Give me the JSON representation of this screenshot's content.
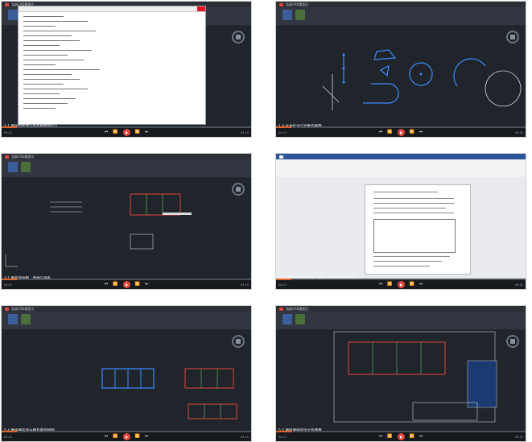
{
  "app": {
    "name": "浩辰CAD看图王"
  },
  "videos": [
    {
      "caption": "1.1 图层的新建与布局视图的切入",
      "time_current": "00:12",
      "time_total": "03:10",
      "progress": 0.06
    },
    {
      "caption": "1.4 文本标注与对象的编辑",
      "time_current": "00:12",
      "time_total": "03:10",
      "progress": 0.06
    },
    {
      "caption": "2.1 图形的绘制、直线与线条",
      "time_current": "00:12",
      "time_total": "03:10",
      "progress": 0.06
    },
    {
      "caption": "3.1 图纸的绘制与设置、规则、属性与其他功能",
      "time_current": "00:12",
      "time_total": "03:10",
      "progress": 0.06
    },
    {
      "caption": "5.4 图纸图形的分图及最后绘制",
      "time_current": "00:12",
      "time_total": "03:10",
      "progress": 0.06
    },
    {
      "caption": "5.5 图纸图纸的设立及使用",
      "time_current": "00:12",
      "time_total": "03:10",
      "progress": 0.06
    }
  ],
  "controls": {
    "prev": "⏮",
    "rewind": "⏪",
    "forward": "⏩",
    "next": "⏭"
  },
  "colors": {
    "accent": "#e4473b",
    "progress": "#e0622a",
    "cad_bg": "#20252c",
    "line_blue": "#3d8bff"
  }
}
